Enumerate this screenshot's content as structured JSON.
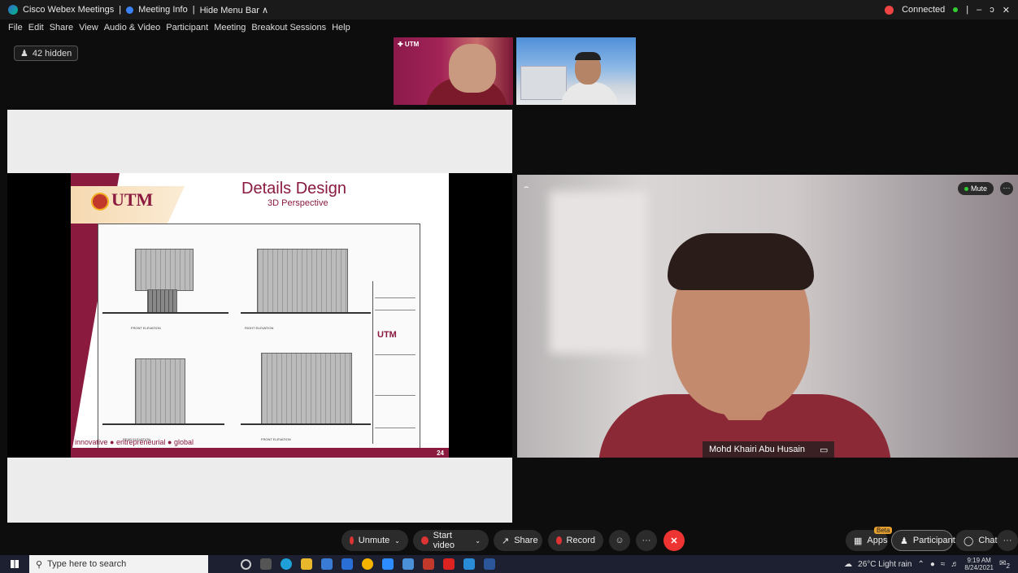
{
  "titlebar": {
    "app": "Cisco Webex Meetings",
    "sep1": "|",
    "meeting_info": "Meeting Info",
    "sep2": "|",
    "hide_menu": "Hide Menu Bar ∧",
    "connected": "Connected",
    "sep3": "|",
    "minimize": "–",
    "restore": "ɔ",
    "close": "✕"
  },
  "menu": [
    "File",
    "Edit",
    "Share",
    "View",
    "Audio & Video",
    "Participant",
    "Meeting",
    "Breakout Sessions",
    "Help"
  ],
  "hidden_participants": "42 hidden",
  "thumb1_logo": "✚ UTM",
  "slide": {
    "title": "Details Design",
    "subtitle": "3D Perspective",
    "logo": "UTM",
    "tagline": "innovative ● entrepreneurial ● global",
    "page": "24",
    "tb_logo": "UTM",
    "labels": [
      "FRONT ELEVATION",
      "RIGHT ELEVATION",
      "REAR ELEVATION",
      "FRONT ELEVATION"
    ]
  },
  "speaker": {
    "name": "Mohd Khairi Abu Husain",
    "mute": "Mute",
    "more": "···",
    "pin": "⌢"
  },
  "controls": {
    "unmute": "Unmute",
    "start_video": "Start video",
    "share": "Share",
    "record": "Record",
    "reactions": "☺",
    "more": "···",
    "end": "✕",
    "apps": "Apps",
    "beta": "Beta",
    "participants": "Participants",
    "chat": "Chat",
    "more_right": "···"
  },
  "taskbar": {
    "search_placeholder": "Type here to search",
    "weather": "26°C Light rain",
    "time": "9:19 AM",
    "date": "8/24/2021",
    "notif": "2"
  },
  "colors": {
    "utm_maroon": "#8a1a3e",
    "end_red": "#e33",
    "connected_green": "#3c3"
  }
}
